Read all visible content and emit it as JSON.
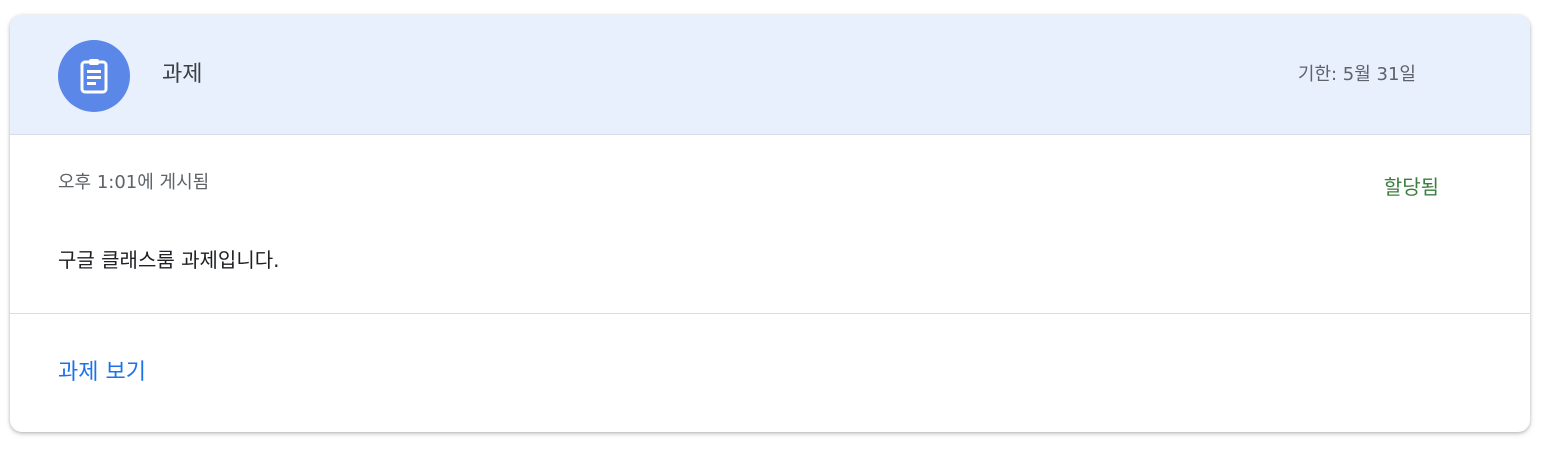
{
  "header": {
    "icon": "assignment-icon",
    "title": "과제",
    "due": "기한: 5월 31일"
  },
  "body": {
    "posted": "오후 1:01에 게시됨",
    "status": "할당됨",
    "description": "구글 클래스룸 과제입니다."
  },
  "footer": {
    "view_label": "과제 보기"
  },
  "colors": {
    "header_bg": "#e8f0fe",
    "icon_bg": "#5b87e8",
    "status": "#3c7d3e",
    "link": "#1a73e8"
  }
}
